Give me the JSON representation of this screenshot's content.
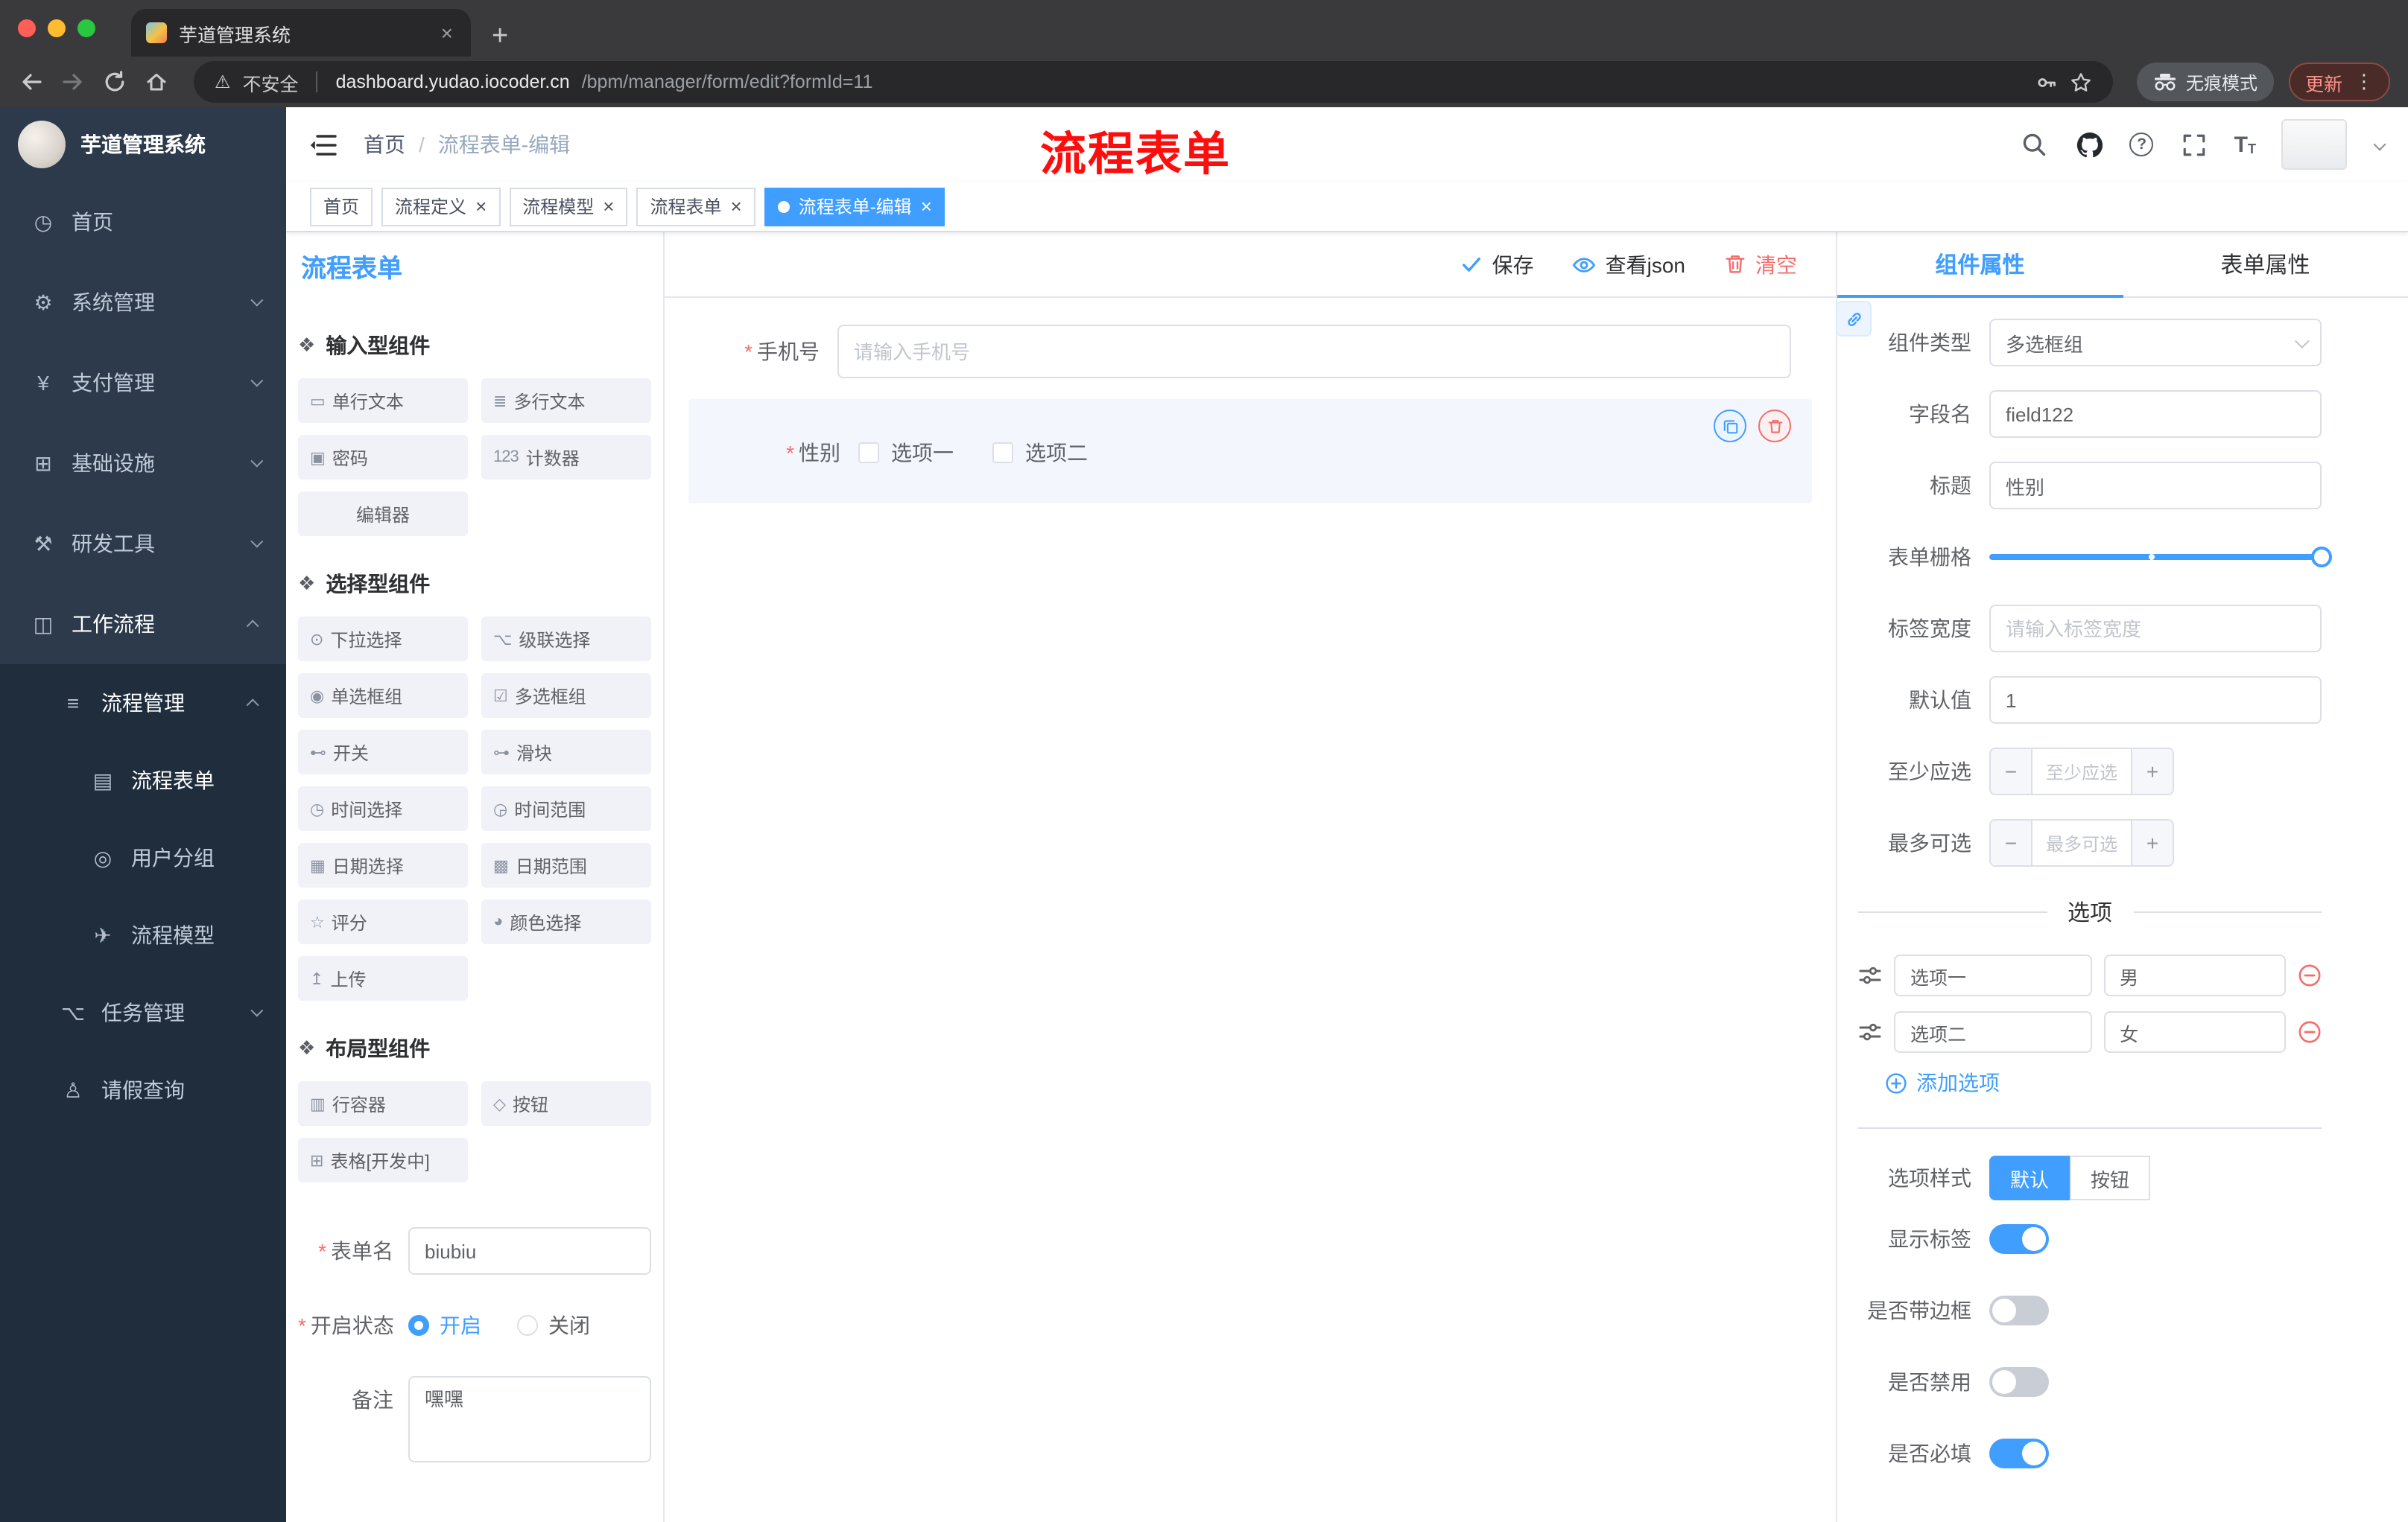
{
  "colors": {
    "accent": "#409eff",
    "danger": "#f56c6c",
    "annotation_red": "#fe0d0d",
    "sidebar_bg": "#2d3a4b",
    "sidebar_sub_bg": "#1f2d3d",
    "tag_active": "#409eff"
  },
  "browser": {
    "tab_title": "芋道管理系统",
    "security_label": "不安全",
    "url_host": "dashboard.yudao.iocoder.cn",
    "url_path": "/bpm/manager/form/edit?formId=11",
    "incognito_label": "无痕模式",
    "update_label": "更新"
  },
  "sidebar": {
    "brand": "芋道管理系统",
    "items": [
      {
        "label": "首页"
      },
      {
        "label": "系统管理"
      },
      {
        "label": "支付管理"
      },
      {
        "label": "基础设施"
      },
      {
        "label": "研发工具"
      },
      {
        "label": "工作流程"
      },
      {
        "label": "流程管理"
      },
      {
        "label": "流程表单"
      },
      {
        "label": "用户分组"
      },
      {
        "label": "流程模型"
      },
      {
        "label": "任务管理"
      },
      {
        "label": "请假查询"
      }
    ]
  },
  "header": {
    "breadcrumb": {
      "home": "首页",
      "current": "流程表单-编辑"
    },
    "annotation": "流程表单"
  },
  "tags": [
    {
      "label": "首页",
      "closable": false,
      "active": false
    },
    {
      "label": "流程定义",
      "closable": true,
      "active": false
    },
    {
      "label": "流程模型",
      "closable": true,
      "active": false
    },
    {
      "label": "流程表单",
      "closable": true,
      "active": false
    },
    {
      "label": "流程表单-编辑",
      "closable": true,
      "active": true
    }
  ],
  "designer": {
    "panel_title": "流程表单",
    "toolbar": {
      "save": "保存",
      "view_json": "查看json",
      "clear": "清空"
    },
    "groups": [
      {
        "title": "输入型组件",
        "items": [
          {
            "label": "单行文本",
            "glyph": "▭",
            "icon": "text-field-icon"
          },
          {
            "label": "多行文本",
            "glyph": "≣",
            "icon": "textarea-icon"
          },
          {
            "label": "密码",
            "glyph": "▣",
            "icon": "password-lock-icon"
          },
          {
            "label": "计数器",
            "glyph": "123",
            "icon": "counter-icon"
          },
          {
            "label": "编辑器",
            "glyph": "",
            "icon": "editor-icon",
            "center": true
          }
        ]
      },
      {
        "title": "选择型组件",
        "items": [
          {
            "label": "下拉选择",
            "glyph": "⊙",
            "icon": "select-icon"
          },
          {
            "label": "级联选择",
            "glyph": "⌥",
            "icon": "cascader-icon"
          },
          {
            "label": "单选框组",
            "glyph": "◉",
            "icon": "radio-group-icon"
          },
          {
            "label": "多选框组",
            "glyph": "☑",
            "icon": "checkbox-group-icon"
          },
          {
            "label": "开关",
            "glyph": "⊷",
            "icon": "switch-icon"
          },
          {
            "label": "滑块",
            "glyph": "⊶",
            "icon": "slider-icon"
          },
          {
            "label": "时间选择",
            "glyph": "◷",
            "icon": "time-picker-icon"
          },
          {
            "label": "时间范围",
            "glyph": "◶",
            "icon": "time-range-icon"
          },
          {
            "label": "日期选择",
            "glyph": "▦",
            "icon": "date-picker-icon"
          },
          {
            "label": "日期范围",
            "glyph": "▩",
            "icon": "date-range-icon"
          },
          {
            "label": "评分",
            "glyph": "☆",
            "icon": "rate-icon"
          },
          {
            "label": "颜色选择",
            "glyph": "◕",
            "icon": "color-picker-icon"
          },
          {
            "label": "上传",
            "glyph": "↥",
            "icon": "upload-icon"
          }
        ]
      },
      {
        "title": "布局型组件",
        "items": [
          {
            "label": "行容器",
            "glyph": "▥",
            "icon": "row-container-icon"
          },
          {
            "label": "按钮",
            "glyph": "◇",
            "icon": "button-icon"
          },
          {
            "label": "表格[开发中]",
            "glyph": "⊞",
            "icon": "table-icon"
          }
        ]
      }
    ],
    "meta": {
      "name_label": "表单名",
      "name_value": "biubiu",
      "status_label": "开启状态",
      "status_options": [
        {
          "label": "开启",
          "selected": true
        },
        {
          "label": "关闭",
          "selected": false
        }
      ],
      "remark_label": "备注",
      "remark_value": "嘿嘿"
    }
  },
  "canvas": {
    "phone": {
      "label": "手机号",
      "placeholder": "请输入手机号"
    },
    "gender": {
      "label": "性别",
      "options": [
        {
          "label": "选项一"
        },
        {
          "label": "选项二"
        }
      ]
    }
  },
  "properties": {
    "tabs": [
      {
        "label": "组件属性",
        "active": true
      },
      {
        "label": "表单属性",
        "active": false
      }
    ],
    "component_type": {
      "label": "组件类型",
      "value": "多选框组"
    },
    "field_name": {
      "label": "字段名",
      "value": "field122"
    },
    "title": {
      "label": "标题",
      "value": "性别"
    },
    "grid": {
      "label": "表单栅格"
    },
    "label_width": {
      "label": "标签宽度",
      "placeholder": "请输入标签宽度"
    },
    "default_value": {
      "label": "默认值",
      "value": "1"
    },
    "min_select": {
      "label": "至少应选",
      "placeholder": "至少应选"
    },
    "max_select": {
      "label": "最多可选",
      "placeholder": "最多可选"
    },
    "options_title": "选项",
    "options": [
      {
        "label": "选项一",
        "value": "男"
      },
      {
        "label": "选项二",
        "value": "女"
      }
    ],
    "add_option_label": "添加选项",
    "option_style": {
      "label": "选项样式",
      "choices": [
        {
          "label": "默认",
          "active": true
        },
        {
          "label": "按钮",
          "active": false
        }
      ]
    },
    "switches": [
      {
        "label": "显示标签",
        "on": true
      },
      {
        "label": "是否带边框",
        "on": false
      },
      {
        "label": "是否禁用",
        "on": false
      },
      {
        "label": "是否必填",
        "on": true
      }
    ]
  }
}
